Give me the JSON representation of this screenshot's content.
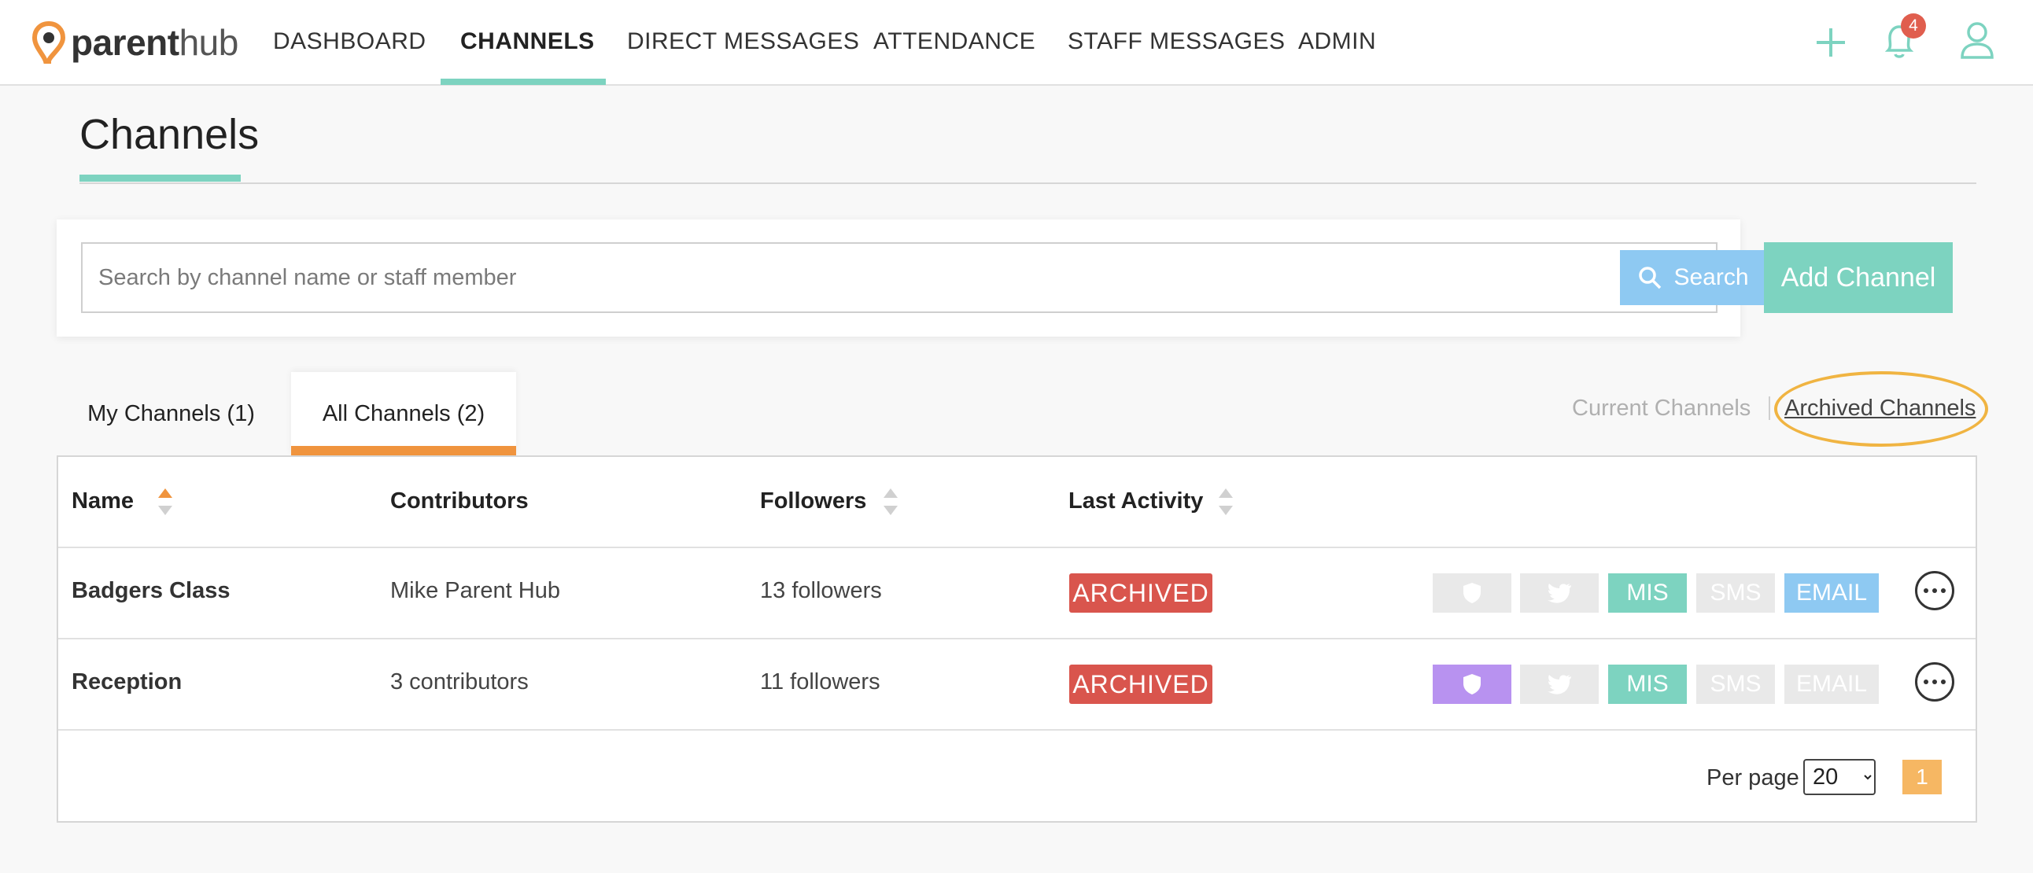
{
  "logo": {
    "bold": "parent",
    "light": "hub"
  },
  "nav": {
    "items": [
      "DASHBOARD",
      "CHANNELS",
      "DIRECT MESSAGES",
      "ATTENDANCE",
      "STAFF MESSAGES",
      "ADMIN"
    ],
    "active": "CHANNELS",
    "notification_count": "4"
  },
  "page": {
    "title": "Channels"
  },
  "search": {
    "placeholder": "Search by channel name or staff member",
    "button_label": "Search"
  },
  "add_channel_label": "Add Channel",
  "tabs": [
    "My Channels (1)",
    "All Channels (2)"
  ],
  "filters": {
    "current": "Current Channels",
    "archived": "Archived Channels"
  },
  "table": {
    "headers": [
      "Name",
      "Contributors",
      "Followers",
      "Last Activity"
    ],
    "rows": [
      {
        "name": "Badgers Class",
        "contributors": "Mike Parent Hub",
        "followers": "13 followers",
        "status": "ARCHIVED",
        "chips": {
          "private": false,
          "twitter": false,
          "mis": true,
          "sms": false,
          "email": true
        }
      },
      {
        "name": "Reception",
        "contributors": "3 contributors",
        "followers": "11 followers",
        "status": "ARCHIVED",
        "chips": {
          "private": true,
          "twitter": false,
          "mis": true,
          "sms": false,
          "email": false
        }
      }
    ],
    "chip_labels": {
      "mis": "MIS",
      "sms": "SMS",
      "email": "EMAIL"
    }
  },
  "pagination": {
    "per_page_label": "Per page",
    "per_page_value": "20",
    "current_page": "1"
  },
  "colors": {
    "accent_teal": "#7dd3c0",
    "tab_orange": "#f0943e",
    "archived_red": "#d9554d",
    "email_blue": "#8ec9f2",
    "private_purple": "#b892f0",
    "highlight": "#f0b442"
  }
}
